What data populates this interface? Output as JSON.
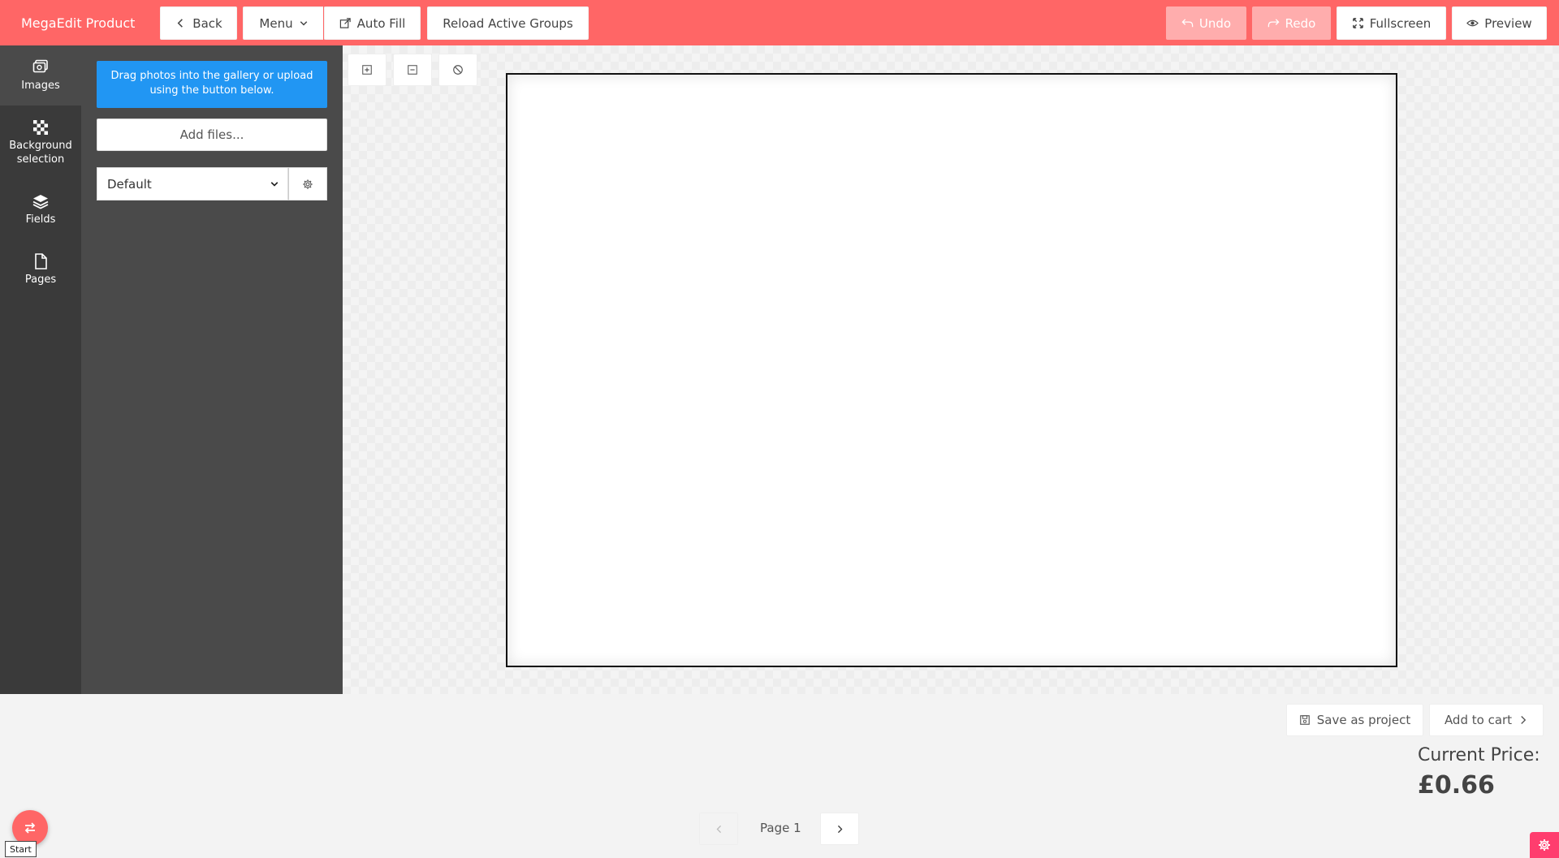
{
  "app": {
    "title": "MegaEdit Product"
  },
  "toolbar": {
    "back_label": "Back",
    "menu_label": "Menu",
    "autofill_label": "Auto Fill",
    "reload_label": "Reload Active Groups",
    "undo_label": "Undo",
    "redo_label": "Redo",
    "fullscreen_label": "Fullscreen",
    "preview_label": "Preview"
  },
  "sidebar": {
    "items": [
      {
        "label": "Images",
        "icon": "images-icon",
        "active": true
      },
      {
        "label": "Background selection",
        "icon": "checkerboard-icon",
        "active": false
      },
      {
        "label": "Fields",
        "icon": "layers-icon",
        "active": false
      },
      {
        "label": "Pages",
        "icon": "page-icon",
        "active": false
      }
    ]
  },
  "panel": {
    "info_text": "Drag photos into the gallery or upload using the button below.",
    "add_files_label": "Add files...",
    "gallery_select_value": "Default"
  },
  "actions": {
    "save_label": "Save as project",
    "add_to_cart_label": "Add to cart"
  },
  "price": {
    "label": "Current Price:",
    "value": "£0.66"
  },
  "pager": {
    "page_label": "Page 1"
  },
  "misc": {
    "start_tooltip": "Start"
  },
  "colors": {
    "topbar": "#ff6666",
    "info_box": "#2196f3",
    "rail": "#3a3a3a",
    "panel": "#4a4a4a",
    "corner_button": "#ff3d6e"
  }
}
